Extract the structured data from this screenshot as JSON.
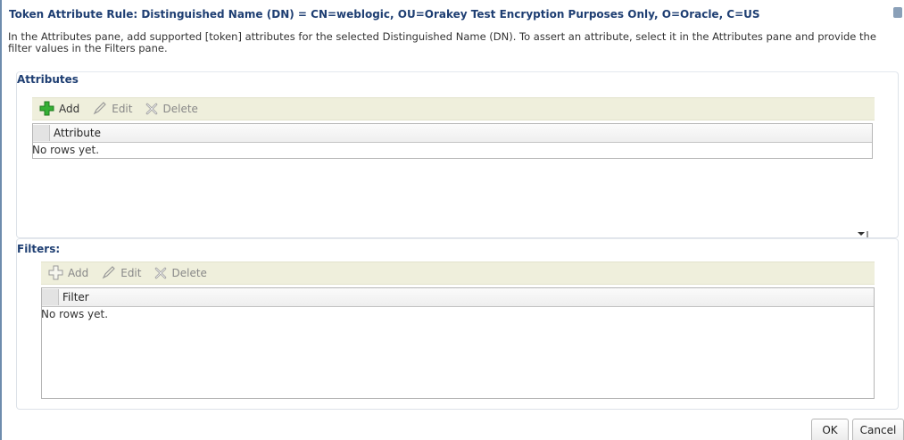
{
  "dialog": {
    "title": "Token Attribute Rule: Distinguished Name (DN) = CN=weblogic, OU=Orakey Test Encryption Purposes Only, O=Oracle, C=US",
    "instruction": "In the Attributes pane, add supported [token] attributes for the selected Distinguished Name (DN). To assert an attribute, select it in the Attributes pane and provide the filter values in the Filters pane."
  },
  "attributes": {
    "section_title": "Attributes",
    "toolbar": {
      "add": "Add",
      "edit": "Edit",
      "delete": "Delete"
    },
    "column": "Attribute",
    "empty_text": "No rows yet."
  },
  "filters": {
    "section_title": "Filters:",
    "toolbar": {
      "add": "Add",
      "edit": "Edit",
      "delete": "Delete"
    },
    "column": "Filter",
    "empty_text": "No rows yet."
  },
  "footer": {
    "ok": "OK",
    "cancel": "Cancel"
  },
  "icons": {
    "add_enabled_color": "#2fa52f",
    "add_disabled": "add-icon",
    "edit": "pencil-icon",
    "delete": "delete-icon"
  }
}
